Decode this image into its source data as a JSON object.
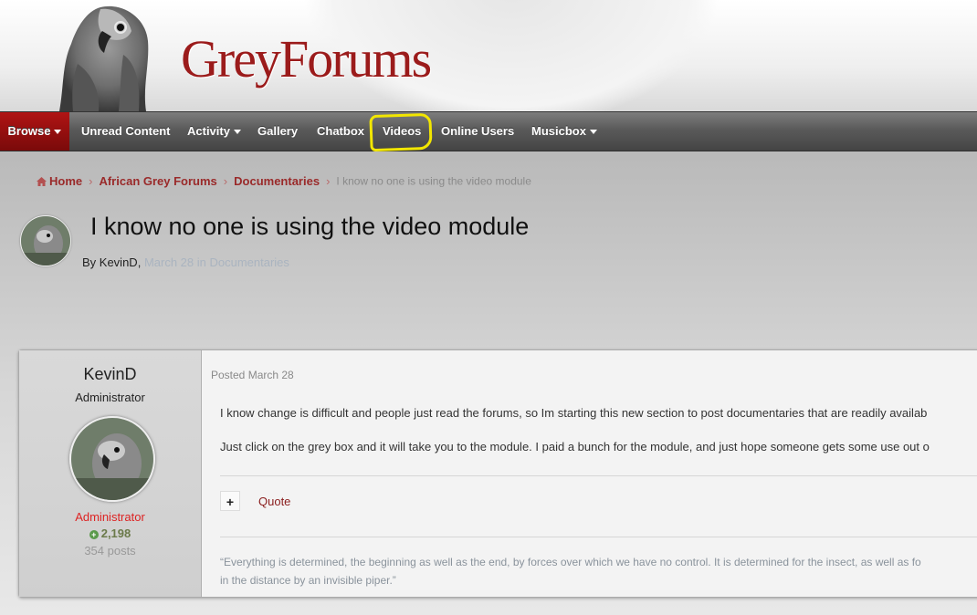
{
  "header": {
    "logo_text": "GreyForums"
  },
  "nav": {
    "items": [
      {
        "label": "Browse",
        "has_dropdown": true,
        "active": true
      },
      {
        "label": "Unread Content",
        "has_dropdown": false
      },
      {
        "label": "Activity",
        "has_dropdown": true
      },
      {
        "label": "Gallery",
        "has_dropdown": false
      },
      {
        "label": "Chatbox",
        "has_dropdown": false
      },
      {
        "label": "Videos",
        "has_dropdown": false,
        "highlighted": true
      },
      {
        "label": "Online Users",
        "has_dropdown": false
      },
      {
        "label": "Musicbox",
        "has_dropdown": true
      }
    ]
  },
  "breadcrumb": {
    "items": [
      "Home",
      "African Grey Forums",
      "Documentaries"
    ],
    "current": "I know no one is using the video module"
  },
  "topic": {
    "title": "I know no one is using the video module",
    "by": "By KevinD,",
    "meta": "March 28 in Documentaries"
  },
  "post": {
    "author": {
      "name": "KevinD",
      "title": "Administrator",
      "group": "Administrator",
      "reputation": "2,198",
      "posts": "354 posts"
    },
    "date": "Posted March 28",
    "paragraphs": [
      "I know change is difficult and people just read the forums, so Im starting this new section to post documentaries that are readily availab",
      "Just click on the grey box and it will take you to the module. I paid a bunch for the module, and just hope someone gets some use out o"
    ],
    "plus_label": "+",
    "quote_label": "Quote",
    "signature": [
      "“Everything is determined, the beginning as well as the end, by forces over which we have no control. It is determined for the insect, as well as fo",
      "in the distance by an invisible piper.”"
    ]
  },
  "colors": {
    "brand_red": "#9b1b1b",
    "nav_active": "#b01414",
    "annotation": "#f2e600"
  }
}
